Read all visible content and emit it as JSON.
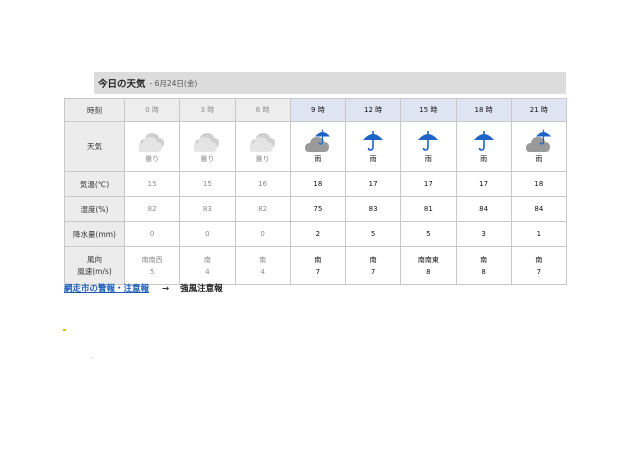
{
  "header": {
    "title": "今日の天気",
    "date": " - 6月24日(金)"
  },
  "rows": {
    "time_label": "時刻",
    "sky_label": "天気",
    "temp_label": "気温(℃)",
    "humidity_label": "湿度(%)",
    "rain_label": "降水量(mm)",
    "wind_dir_label": "風向",
    "wind_speed_label": "風速(m/s)"
  },
  "columns": [
    {
      "time": "0 時",
      "sky": "曇り",
      "icon": "cloud-icon",
      "temp": "15",
      "humidity": "82",
      "rain": "0",
      "wind_dir": "南南西",
      "wind_speed": "5",
      "past": true
    },
    {
      "time": "3 時",
      "sky": "曇り",
      "icon": "cloud-icon",
      "temp": "15",
      "humidity": "83",
      "rain": "0",
      "wind_dir": "南",
      "wind_speed": "4",
      "past": true
    },
    {
      "time": "6 時",
      "sky": "曇り",
      "icon": "cloud-icon",
      "temp": "16",
      "humidity": "82",
      "rain": "0",
      "wind_dir": "南",
      "wind_speed": "4",
      "past": true
    },
    {
      "time": "9 時",
      "sky": "雨",
      "icon": "cloud-umbrella-icon",
      "temp": "18",
      "humidity": "75",
      "rain": "2",
      "wind_dir": "南",
      "wind_speed": "7",
      "past": false
    },
    {
      "time": "12 時",
      "sky": "雨",
      "icon": "umbrella-icon",
      "temp": "17",
      "humidity": "83",
      "rain": "5",
      "wind_dir": "南",
      "wind_speed": "7",
      "past": false
    },
    {
      "time": "15 時",
      "sky": "雨",
      "icon": "umbrella-icon",
      "temp": "17",
      "humidity": "81",
      "rain": "5",
      "wind_dir": "南南東",
      "wind_speed": "8",
      "past": false
    },
    {
      "time": "18 時",
      "sky": "雨",
      "icon": "umbrella-icon",
      "temp": "17",
      "humidity": "84",
      "rain": "3",
      "wind_dir": "南",
      "wind_speed": "8",
      "past": false
    },
    {
      "time": "21 時",
      "sky": "雨",
      "icon": "cloud-umbrella-icon",
      "temp": "18",
      "humidity": "84",
      "rain": "1",
      "wind_dir": "南",
      "wind_speed": "7",
      "past": false
    }
  ],
  "warning": {
    "link": "網走市の警報・注意報",
    "arrow": "→",
    "text": "強風注意報"
  },
  "colors": {
    "umbrella": "#1f63c8",
    "cloud_past": "#cfcfcf",
    "cloud_now": "#9a9a9a",
    "link": "#1a5bb5"
  }
}
